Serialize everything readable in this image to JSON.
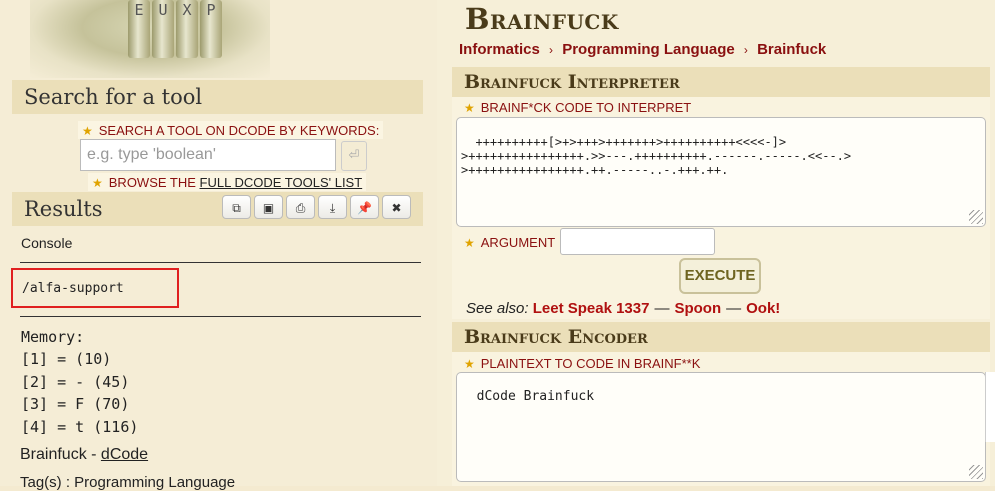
{
  "banner": {
    "letters": [
      "E",
      "U",
      "X",
      "P"
    ]
  },
  "search": {
    "title": "Search for a tool",
    "label": "Search a tool on dCode by keywords:",
    "placeholder": "e.g. type 'boolean'",
    "go_icon": "⏎",
    "browse_prefix": "Browse the ",
    "browse_link": "full dCode tools' list"
  },
  "results": {
    "title": "Results",
    "toolbar_icons": [
      "copy-icon",
      "camera-icon",
      "print-icon",
      "download-icon",
      "pin-icon",
      "close-icon"
    ],
    "console_label": "Console",
    "console_text": "/alfa-support",
    "memory_heading": "Memory:",
    "memory": [
      "[1] =  (10)",
      "[2] = - (45)",
      "[3] = F (70)",
      "[4] = t (116)"
    ],
    "footer_name": "Brainfuck - ",
    "footer_link": "dCode",
    "tags": "Tag(s) : Programming Language"
  },
  "header": {
    "title": "Brainfuck",
    "breadcrumb": [
      "Informatics",
      "Programming Language",
      "Brainfuck"
    ]
  },
  "interpreter": {
    "title": "Brainfuck Interpreter",
    "code_label": "Brainf*ck code to interpret",
    "code": "++++++++++[>+>+++>+++++++>++++++++++<<<<-]>\n>++++++++++++++++.>>---.++++++++++.------.-----.<<--.>\n>++++++++++++++++.++.-----..-.+++.++.",
    "argument_label": "Argument",
    "argument_value": "",
    "execute": "EXECUTE",
    "see_also_label": "See also:",
    "see_also": [
      "Leet Speak 1337",
      "Spoon",
      "Ook!"
    ]
  },
  "encoder": {
    "title": "Brainfuck Encoder",
    "plaintext_label": "Plaintext to code in Brainf**k",
    "plaintext": "dCode Brainfuck"
  },
  "colors": {
    "accent_red": "#8a1010",
    "link_red": "#b01010",
    "panel_bg": "#ebdfb9",
    "page_bg": "#f5edd6",
    "title_brown": "#4a3b1a",
    "highlight_box": "#e02020"
  }
}
